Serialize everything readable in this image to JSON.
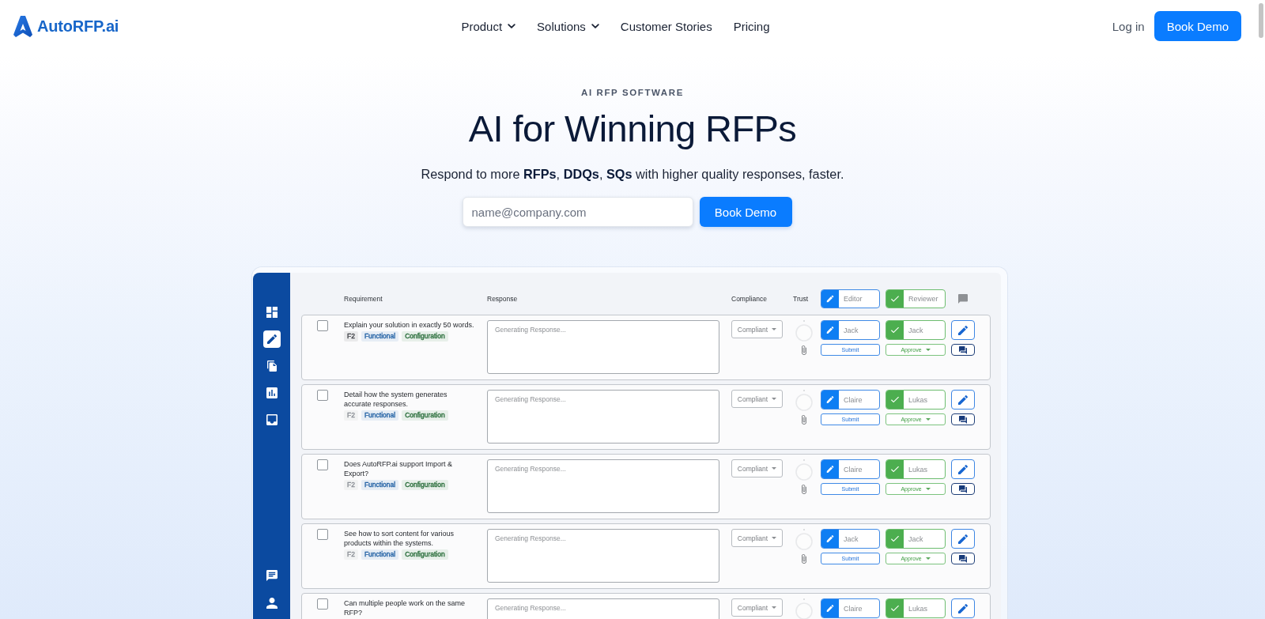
{
  "nav": {
    "logo": "AutoRFP.ai",
    "links": [
      {
        "label": "Product",
        "dropdown": true
      },
      {
        "label": "Solutions",
        "dropdown": true
      },
      {
        "label": "Customer Stories",
        "dropdown": false
      },
      {
        "label": "Pricing",
        "dropdown": false
      }
    ],
    "login": "Log in",
    "cta": "Book Demo"
  },
  "hero": {
    "eyebrow": "AI RFP SOFTWARE",
    "title": "AI for Winning RFPs",
    "subtitle": "Respond to more **RFPs**, **DDQs**, **SQs** with higher quality responses, faster.",
    "email": {
      "placeholder": "name@company.com"
    },
    "cta": "Book Demo"
  },
  "app": {
    "sidebar": {
      "items": [
        {
          "selected": false
        },
        {
          "selected": true
        },
        {
          "selected": false
        },
        {
          "selected": false
        },
        {
          "selected": false
        }
      ],
      "bottom_items": [
        {
          "selected": false
        },
        {
          "selected": false
        }
      ]
    },
    "table": {
      "columns": [
        "Requirement",
        "Response",
        "Compliance",
        "Trust"
      ],
      "editor_filter": "Editor",
      "reviewer_filter": "Reviewer",
      "rows": [
        {
          "checked": false,
          "requirement": "Explain your solution in exactly 50 words.",
          "tags": [
            {
              "label": "F2",
              "color": "#3f4046"
            },
            {
              "label": "Functional",
              "color": "#1f5fa3"
            },
            {
              "label": "Configuration",
              "color": "#256b37"
            }
          ],
          "response": {
            "placeholder": "Generating Response..."
          },
          "compliance": "Compliant",
          "editor": "Jack",
          "reviewer": "Jack",
          "submit": "Submit",
          "approve": "Approve"
        },
        {
          "checked": false,
          "requirement": "Detail how the system generates accurate responses.",
          "tags": [
            {
              "label": "F2",
              "color": "#8a8e95"
            },
            {
              "label": "Functional",
              "color": "#1f5fa3"
            },
            {
              "label": "Configuration",
              "color": "#256b37"
            }
          ],
          "response": {
            "placeholder": "Generating Response..."
          },
          "compliance": "Compliant",
          "editor": "Claire",
          "reviewer": "Lukas",
          "submit": "Submit",
          "approve": "Approve"
        },
        {
          "checked": false,
          "requirement": "Does AutoRFP.ai support Import & Export?",
          "tags": [
            {
              "label": "F2",
              "color": "#8a8e95"
            },
            {
              "label": "Functional",
              "color": "#1f5fa3"
            },
            {
              "label": "Configuration",
              "color": "#256b37"
            }
          ],
          "response": {
            "placeholder": "Generating Response..."
          },
          "compliance": "Compliant",
          "editor": "Claire",
          "reviewer": "Lukas",
          "submit": "Submit",
          "approve": "Approve"
        },
        {
          "checked": false,
          "requirement": "See how to sort content for various products within the systems.",
          "tags": [
            {
              "label": "F2",
              "color": "#8a8e95"
            },
            {
              "label": "Functional",
              "color": "#1f5fa3"
            },
            {
              "label": "Configuration",
              "color": "#256b37"
            }
          ],
          "response": {
            "placeholder": "Generating Response..."
          },
          "compliance": "Compliant",
          "editor": "Jack",
          "reviewer": "Jack",
          "submit": "Submit",
          "approve": "Approve"
        },
        {
          "checked": false,
          "requirement": "Can multiple people work on the same RFP?",
          "response": {
            "placeholder": "Generating Response..."
          },
          "compliance": "Compliant",
          "editor": "Claire",
          "reviewer": "Lukas"
        }
      ]
    }
  }
}
